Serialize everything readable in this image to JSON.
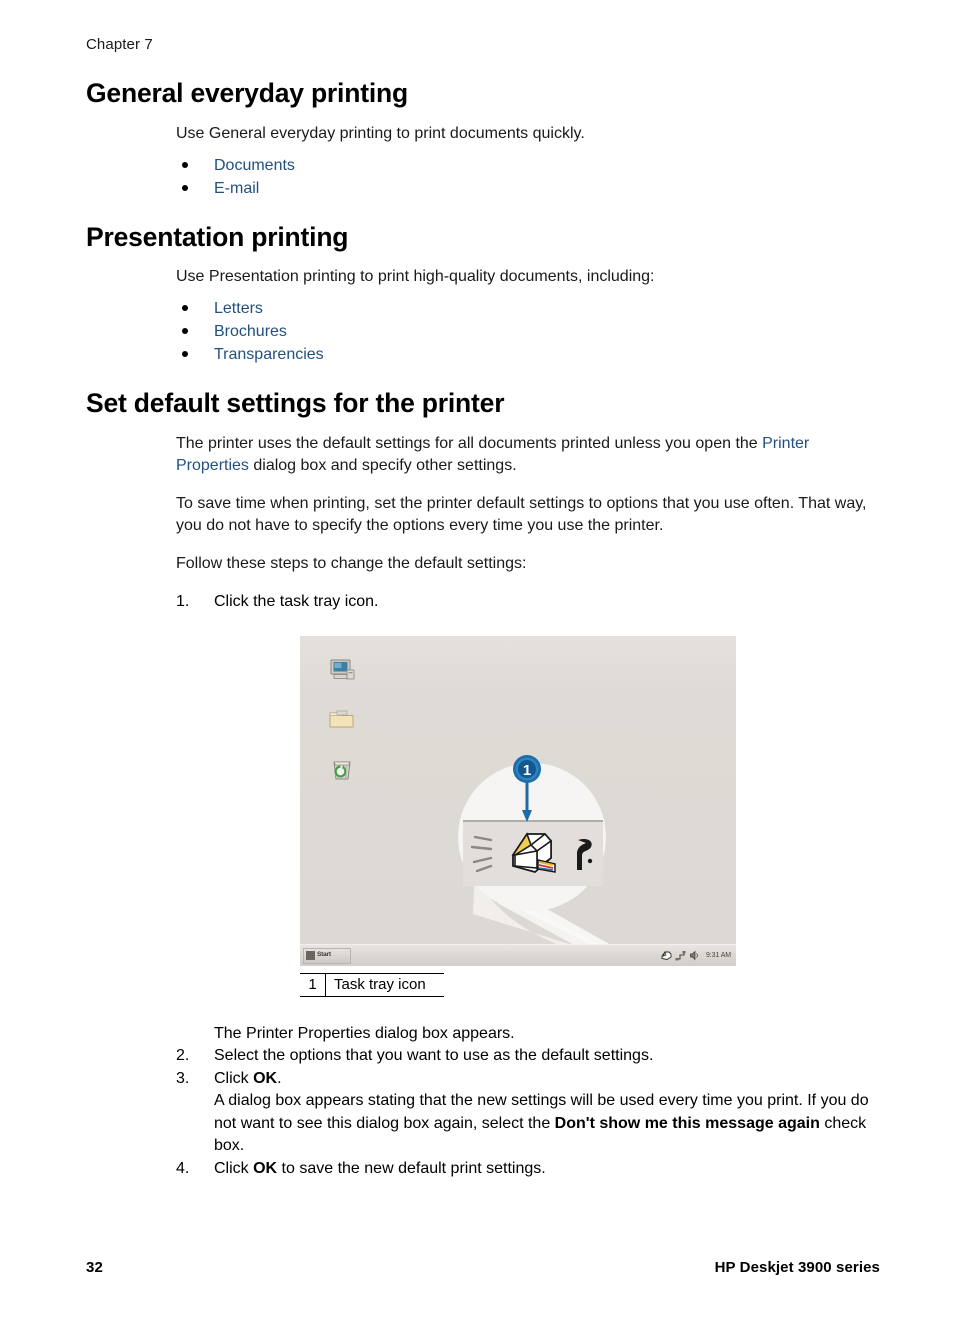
{
  "header": {
    "chapter": "Chapter 7"
  },
  "sections": [
    {
      "title": "General everyday printing",
      "intro": "Use General everyday printing to print documents quickly.",
      "bullets": [
        "Documents",
        "E-mail"
      ]
    },
    {
      "title": "Presentation printing",
      "intro": "Use Presentation printing to print high-quality documents, including:",
      "bullets": [
        "Letters",
        "Brochures",
        "Transparencies"
      ]
    }
  ],
  "default_settings": {
    "title": "Set default settings for the printer",
    "para1_before_link": "The printer uses the default settings for all documents printed unless you open the ",
    "para1_link": "Printer Properties",
    "para1_after_link": " dialog box and specify other settings.",
    "para2": "To save time when printing, set the printer default settings to options that you use often. That way, you do not have to specify the options every time you use the printer.",
    "para3": "Follow these steps to change the default settings:",
    "step1_num": "1.",
    "step1": "Click the task tray icon.",
    "figure_note": "The Printer Properties dialog box appears.",
    "step2_num": "2.",
    "step2": "Select the options that you want to use as the default settings.",
    "step3_num": "3.",
    "step3_before": "Click ",
    "step3_bold": "OK",
    "step3_after": ".",
    "step3_detail_a": "A dialog box appears stating that the new settings will be used every time you print. If you do not want to see this dialog box again, select the ",
    "step3_detail_bold": "Don't show me this message again",
    "step3_detail_b": " check box.",
    "step4_num": "4.",
    "step4_before": "Click ",
    "step4_bold": "OK",
    "step4_after": " to save the new default print settings."
  },
  "figure": {
    "caption_number": "1",
    "caption_text": "Task tray icon",
    "callout_badge": "1",
    "taskbar": {
      "start_label": "Start",
      "clock": "9:31 AM"
    },
    "desktop_icons": [
      "my-computer-icon",
      "folder-icon",
      "recycle-bin-icon"
    ],
    "tray_icons": [
      "printer-tray-icon",
      "network-tray-icon",
      "volume-tray-icon"
    ],
    "colors": {
      "desktop_background": "#dedad5",
      "badge_blue": "#1b6ca8",
      "magnifier_fill": "#f7f5f3"
    }
  },
  "footer": {
    "page_number": "32",
    "product": "HP Deskjet 3900 series"
  }
}
